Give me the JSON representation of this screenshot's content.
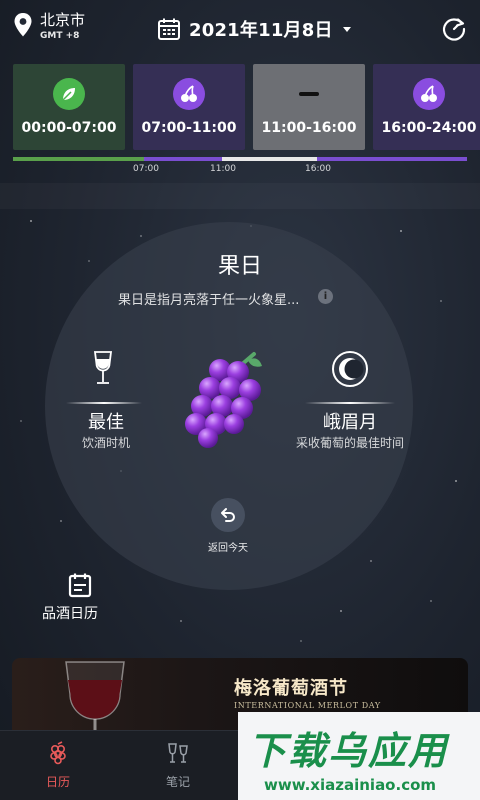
{
  "header": {
    "city": "北京市",
    "timezone": "GMT +8",
    "date": "2021年11月8日"
  },
  "slots": [
    {
      "label": "00:00-07:00",
      "icon": "leaf-icon",
      "color": "#4ab64d"
    },
    {
      "label": "07:00-11:00",
      "icon": "cherry-icon",
      "color": "#8a4de0"
    },
    {
      "label": "11:00-16:00",
      "icon": "dash-icon",
      "color": "#6d6f74"
    },
    {
      "label": "16:00-24:00",
      "icon": "cherry-icon",
      "color": "#8a4de0"
    }
  ],
  "timeline": {
    "ticks": [
      "07:00",
      "11:00",
      "16:00"
    ],
    "colors": {
      "root": "#5aa04b",
      "fruit": "#7a4ed0",
      "none": "#e8e8e8"
    }
  },
  "day": {
    "title": "果日",
    "description": "果日是指月亮落于任一火象星...",
    "info": "i"
  },
  "best": {
    "title": "最佳",
    "subtitle": "饮酒时机"
  },
  "moon": {
    "title": "峨眉月",
    "subtitle": "采收葡萄的最佳时间"
  },
  "back": {
    "label": "返回今天"
  },
  "wine_calendar": {
    "label": "品酒日历"
  },
  "banner": {
    "title": "梅洛葡萄酒节",
    "subtitle": "INTERNATIONAL MERLOT DAY"
  },
  "tabs": [
    {
      "label": "日历",
      "icon": "calendar-grape-icon",
      "active": true
    },
    {
      "label": "笔记",
      "icon": "wine-glasses-icon",
      "active": false
    }
  ],
  "watermark": {
    "line1": "下载乌应用",
    "line2": "www.xiazainiao.com"
  }
}
